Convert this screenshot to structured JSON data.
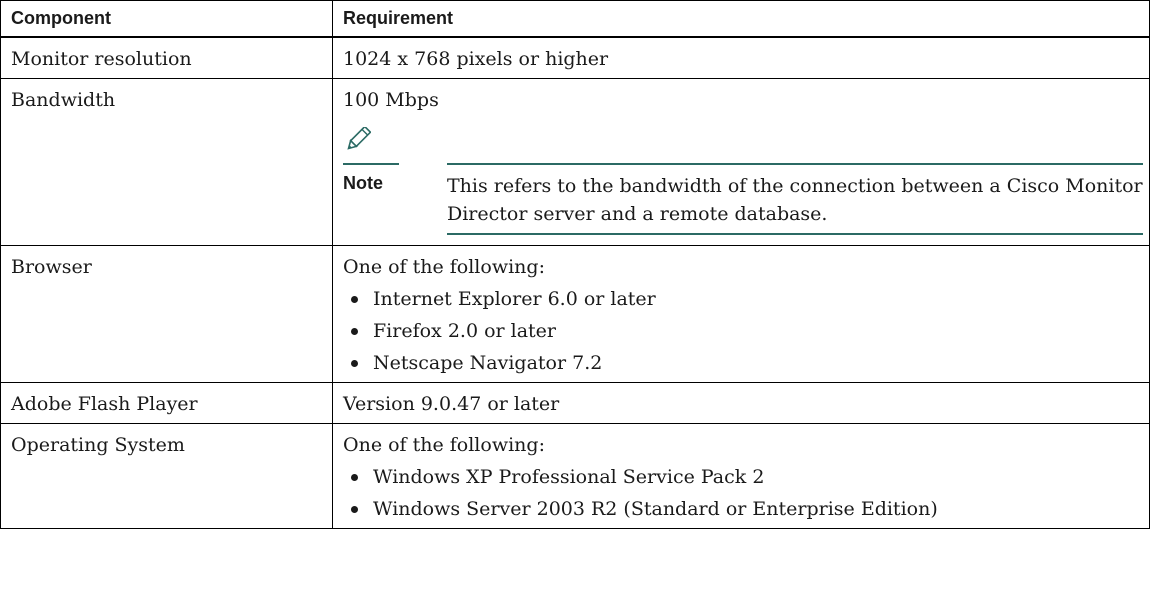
{
  "table": {
    "headers": [
      "Component",
      "Requirement"
    ],
    "rows": [
      {
        "component": "Monitor resolution",
        "requirement": "1024 x 768 pixels or higher"
      },
      {
        "component": "Bandwidth",
        "requirement": "100 Mbps",
        "note": {
          "icon": "pencil-note-icon",
          "label": "Note",
          "text": "This refers to the bandwidth of the connection between a Cisco Monitor Director server and a remote database."
        }
      },
      {
        "component": "Browser",
        "requirement": "One of the following:",
        "bullets": [
          "Internet Explorer 6.0 or later",
          "Firefox 2.0 or later",
          "Netscape Navigator 7.2"
        ]
      },
      {
        "component": "Adobe Flash Player",
        "requirement": "Version 9.0.47 or later"
      },
      {
        "component": "Operating System",
        "requirement": "One of the following:",
        "bullets": [
          "Windows XP Professional Service Pack 2",
          "Windows Server 2003 R2 (Standard or Enterprise Edition)"
        ]
      }
    ]
  },
  "colors": {
    "note_rule": "#2b6a64",
    "text": "#1a1a1a",
    "border": "#000000"
  }
}
